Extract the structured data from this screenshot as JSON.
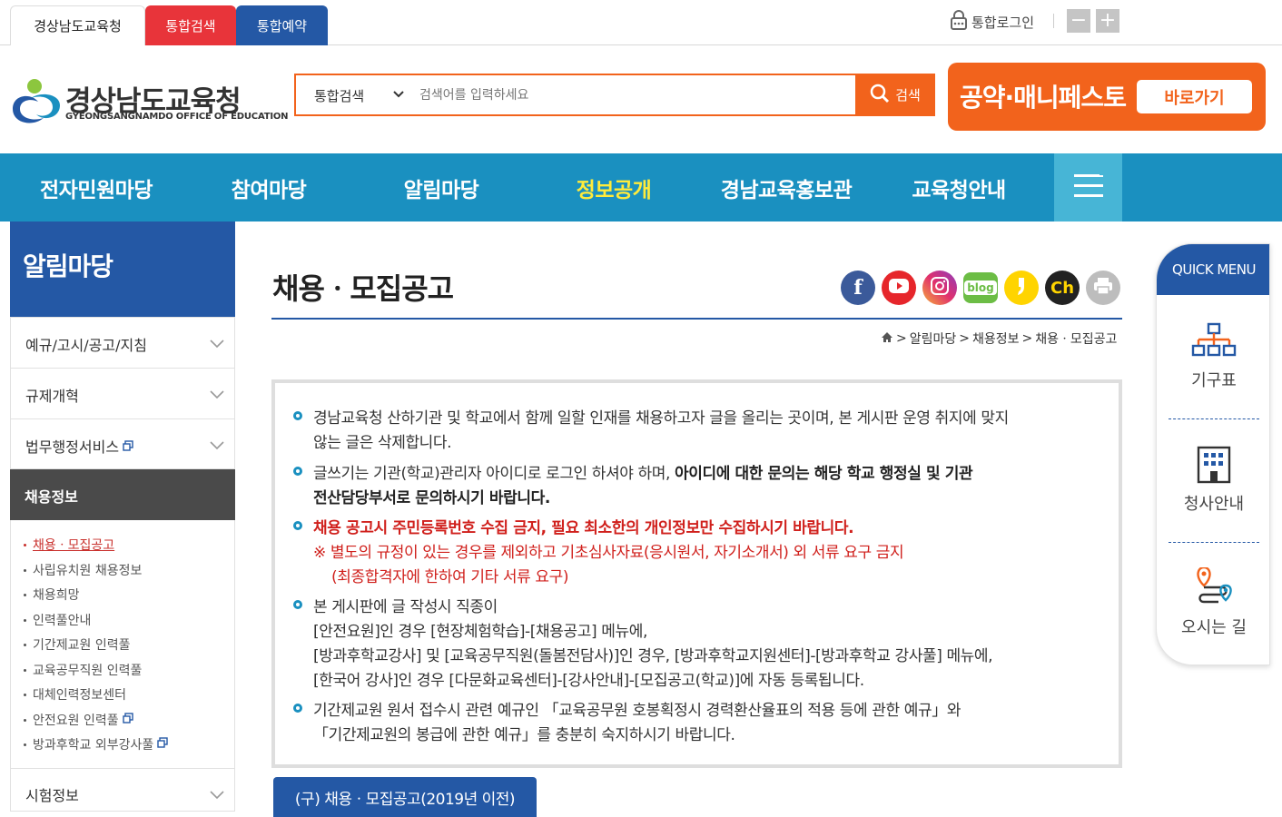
{
  "topbar": {
    "tabs": [
      {
        "label": "경상남도교육청"
      },
      {
        "label": "통합검색"
      },
      {
        "label": "통합예약"
      }
    ],
    "login_label": "통합로그인",
    "zoom_out": "−",
    "zoom_in": "+"
  },
  "header": {
    "logo_title": "경상남도교육청",
    "logo_subtitle": "GYEONGSANGNAMDO OFFICE OF EDUCATION",
    "search_scope": "통합검색",
    "search_placeholder": "검색어를 입력하세요",
    "search_button": "검색",
    "manifesto_title": "공약·매니페스토",
    "manifesto_button": "바로가기"
  },
  "gnb": {
    "items": [
      {
        "label": "전자민원마당"
      },
      {
        "label": "참여마당"
      },
      {
        "label": "알림마당"
      },
      {
        "label": "정보공개"
      },
      {
        "label": "경남교육홍보관"
      },
      {
        "label": "교육청안내"
      }
    ]
  },
  "lnb": {
    "title": "알림마당",
    "items": [
      {
        "label": "예규/고시/공고/지침"
      },
      {
        "label": "규제개혁"
      },
      {
        "label": "법무행정서비스"
      }
    ],
    "active": "채용정보",
    "subitems": [
      {
        "label": "채용ㆍ모집공고"
      },
      {
        "label": "사립유치원 채용정보"
      },
      {
        "label": "채용희망"
      },
      {
        "label": "인력풀안내"
      },
      {
        "label": "기간제교원 인력풀"
      },
      {
        "label": "교육공무직원 인력풀"
      },
      {
        "label": "대체인력정보센터"
      },
      {
        "label": "안전요원 인력풀"
      },
      {
        "label": "방과후학교 외부강사풀"
      }
    ],
    "last_item": "시험정보"
  },
  "content": {
    "page_title": "채용ㆍ모집공고",
    "breadcrumb": [
      "알림마당",
      "채용정보",
      "채용ㆍ모집공고"
    ],
    "sns": {
      "facebook": "f",
      "kakao_story": "",
      "blog": "blog",
      "kakao_channel": "Ch"
    },
    "notice": {
      "p1_l1": "경남교육청 산하기관 및 학교에서 함께 일할 인재를 채용하고자 글을 올리는 곳이며, 본 게시판 운영 취지에 맞지",
      "p1_l2": "않는 글은 삭제합니다.",
      "p2_l1_a": "글쓰기는 기관(학교)관리자 아이디로 로그인 하셔야 하며, ",
      "p2_l1_b": "아이디에 대한 문의는 해당 학교 행정실 및 기관",
      "p2_l2": "전산담당부서로 문의하시기 바랍니다.",
      "p3_l1": "채용 공고시 주민등록번호 수집 금지, 필요 최소한의 개인정보만 수집하시기 바랍니다.",
      "p3_l2": "※ 별도의 규정이 있는 경우를 제외하고 기초심사자료(응시원서, 자기소개서) 외 서류 요구 금지",
      "p3_l3": "(최종합격자에 한하여 기타 서류 요구)",
      "p4_l1": "본 게시판에 글 작성시 직종이",
      "p4_l2": "[안전요원]인 경우 [현장체험학습]-[채용공고] 메뉴에,",
      "p4_l3": "[방과후학교강사] 및 [교육공무직원(돌봄전담사)]인 경우, [방과후학교지원센터]-[방과후학교 강사풀] 메뉴에,",
      "p4_l4": "[한국어 강사]인 경우 [다문화교육센터]-[강사안내]-[모집공고(학교)]에 자동 등록됩니다.",
      "p5_l1": "기간제교원 원서 접수시 관련 예규인 「교육공무원 호봉획정시 경력환산율표의 적용 등에 관한 예규」와",
      "p5_l2": "「기간제교원의 봉급에 관한 예규」를 충분히 숙지하시기 바랍니다."
    },
    "old_board_button": "(구) 채용ㆍ모집공고(2019년 이전)"
  },
  "quick_menu": {
    "title": "QUICK MENU",
    "items": [
      {
        "label": "기구표"
      },
      {
        "label": "청사안내"
      },
      {
        "label": "오시는 길"
      }
    ]
  },
  "colors": {
    "primary_blue": "#2458a5",
    "gnb_blue": "#1a90c0",
    "orange": "#f2631c",
    "red": "#e8343a"
  }
}
